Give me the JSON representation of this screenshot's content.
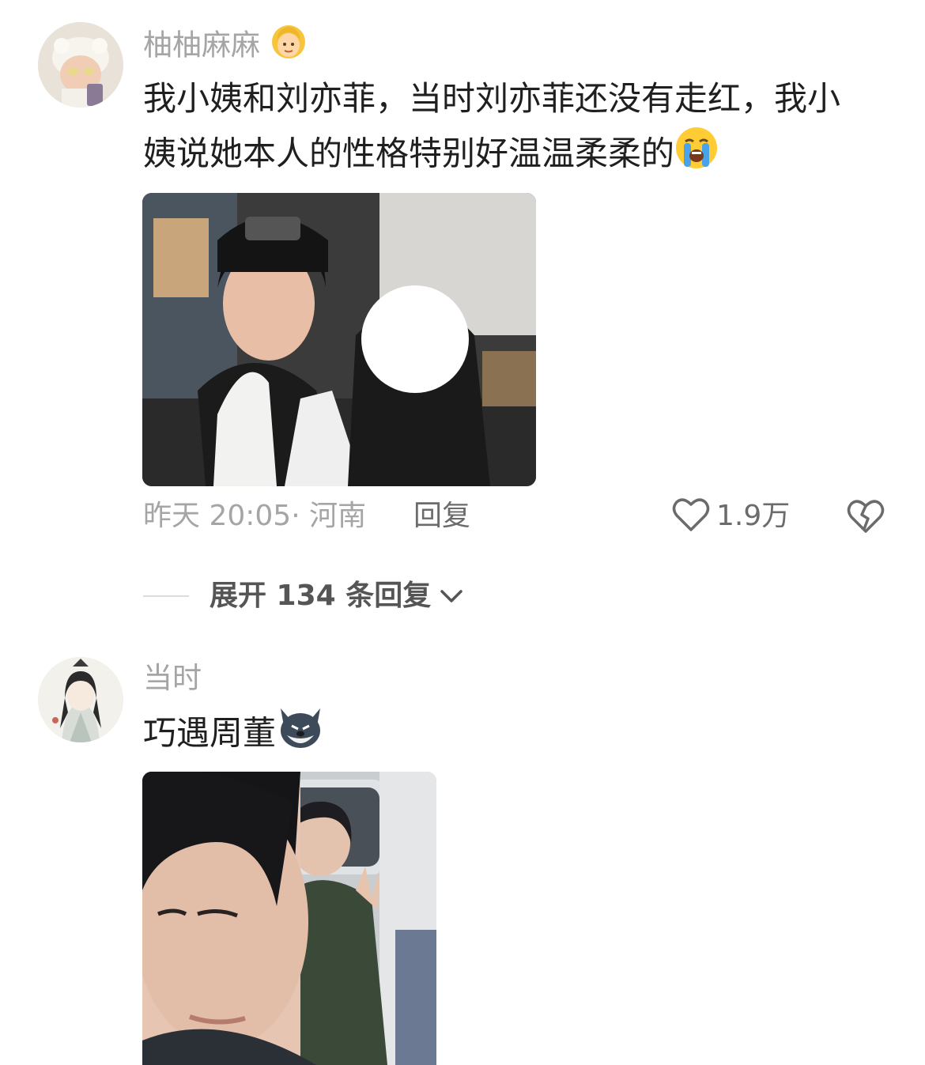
{
  "comments": [
    {
      "username": "柚柚麻麻",
      "username_emoji": "woman-blonde-emoji",
      "text_line1": "我小姨和刘亦菲，当时刘亦菲还没有走红，我小",
      "text_line2": "姨说她本人的性格特别好温温柔柔的",
      "text_emoji": "crying-face-emoji",
      "timestamp": "昨天 20:05· 河南",
      "reply_label": "回复",
      "like_count": "1.9万",
      "expand_label": "展开 134 条回复"
    },
    {
      "username": "当时",
      "text": "巧遇周董",
      "text_emoji": "husky-dog-emoji"
    }
  ],
  "colors": {
    "username": "#a5a5a5",
    "body_text": "#1f1f1f",
    "meta": "#a5a5a5",
    "action": "#6b6b6b"
  }
}
